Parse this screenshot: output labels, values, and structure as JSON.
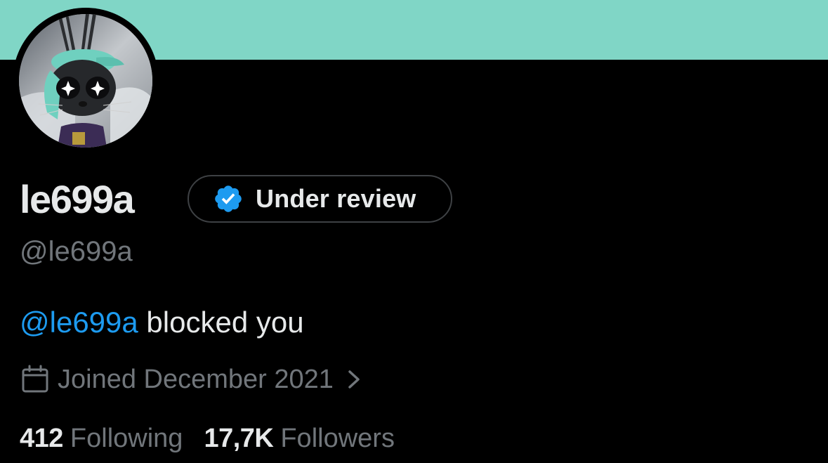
{
  "colors": {
    "banner": "#80d6c6",
    "background": "#000000",
    "primary_text": "#e7e9ea",
    "secondary_text": "#71767b",
    "link": "#1d9bf0",
    "badge_border": "#3e4144"
  },
  "profile": {
    "display_name": "le699a",
    "handle": "@le699a",
    "avatar_icon": "avatar-image",
    "badge": {
      "icon": "verified-check-icon",
      "label": "Under review"
    },
    "blocked_notice": {
      "mention": "@le699a",
      "text": " blocked you"
    },
    "joined": {
      "icon": "calendar-icon",
      "text": "Joined December 2021",
      "chevron_icon": "chevron-right-icon"
    },
    "stats": {
      "following_count": "412",
      "following_label": "Following",
      "followers_count": "17,7K",
      "followers_label": "Followers"
    }
  }
}
